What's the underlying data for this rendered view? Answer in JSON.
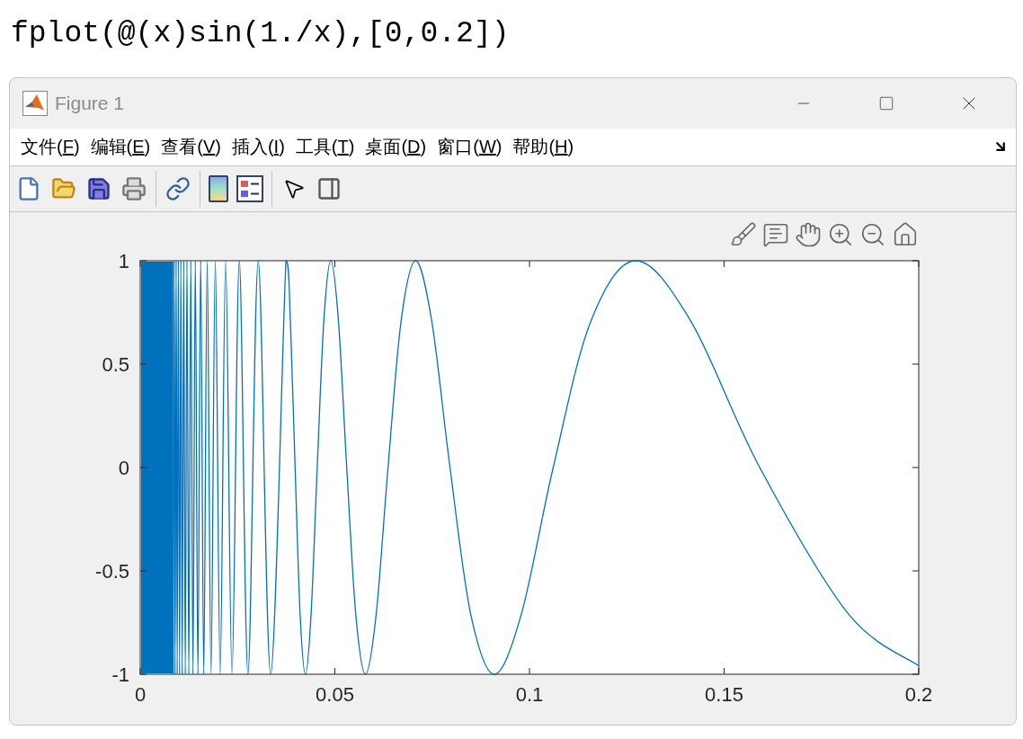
{
  "command": "fplot(@(x)sin(1./x),[0,0.2])",
  "window": {
    "title": "Figure 1"
  },
  "menu": [
    {
      "before": "文件(",
      "key": "F",
      "after": ")"
    },
    {
      "before": "编辑(",
      "key": "E",
      "after": ")"
    },
    {
      "before": "查看(",
      "key": "V",
      "after": ")"
    },
    {
      "before": "插入(",
      "key": "I",
      "after": ")"
    },
    {
      "before": "工具(",
      "key": "T",
      "after": ")"
    },
    {
      "before": "桌面(",
      "key": "D",
      "after": ")"
    },
    {
      "before": "窗口(",
      "key": "W",
      "after": ")"
    },
    {
      "before": "帮助(",
      "key": "H",
      "after": ")"
    }
  ],
  "chart_data": {
    "type": "line",
    "xlim": [
      0,
      0.2
    ],
    "ylim": [
      -1,
      1
    ],
    "xticks": [
      0,
      0.05,
      0.1,
      0.15,
      0.2
    ],
    "yticks": [
      -1,
      -0.5,
      0,
      0.5,
      1
    ],
    "x": [
      0.00849,
      0.00872,
      0.00897,
      0.00923,
      0.0095,
      0.00979,
      0.01011,
      0.01044,
      0.01079,
      0.01117,
      0.01157,
      0.01201,
      0.01248,
      0.01299,
      0.01355,
      0.01415,
      0.01481,
      0.01553,
      0.01632,
      0.01721,
      0.01819,
      0.01929,
      0.02054,
      0.02195,
      0.02358,
      0.02546,
      0.02768,
      0.03032,
      0.03351,
      0.03745,
      0.03858,
      0.03979,
      0.04107,
      0.04244,
      0.0439,
      0.04547,
      0.04716,
      0.04897,
      0.05093,
      0.05305,
      0.05536,
      0.05787,
      0.06063,
      0.06366,
      0.06701,
      0.07074,
      0.0749,
      0.07958,
      0.08488,
      0.09095,
      0.09794,
      0.1061,
      0.11575,
      0.12732,
      0.14147,
      0.15915,
      0.18189,
      0.2
    ],
    "series": [
      {
        "color": "#0072bd",
        "values": [
          -1,
          1,
          -1,
          1,
          -1,
          1,
          -1,
          1,
          -1,
          1,
          -1,
          1,
          -1,
          1,
          -1,
          1,
          -1,
          1,
          -1,
          1,
          -1,
          1,
          -1,
          1,
          -1,
          1,
          -1,
          1,
          -1,
          1,
          0.707,
          0,
          -0.707,
          -1,
          -0.707,
          0,
          0.707,
          1,
          0.707,
          0,
          -0.707,
          -1,
          -0.707,
          0,
          0.707,
          1,
          0.707,
          0,
          -0.707,
          -1,
          -0.707,
          0,
          0.707,
          1,
          0.707,
          0,
          -0.707,
          -0.959
        ]
      }
    ]
  }
}
